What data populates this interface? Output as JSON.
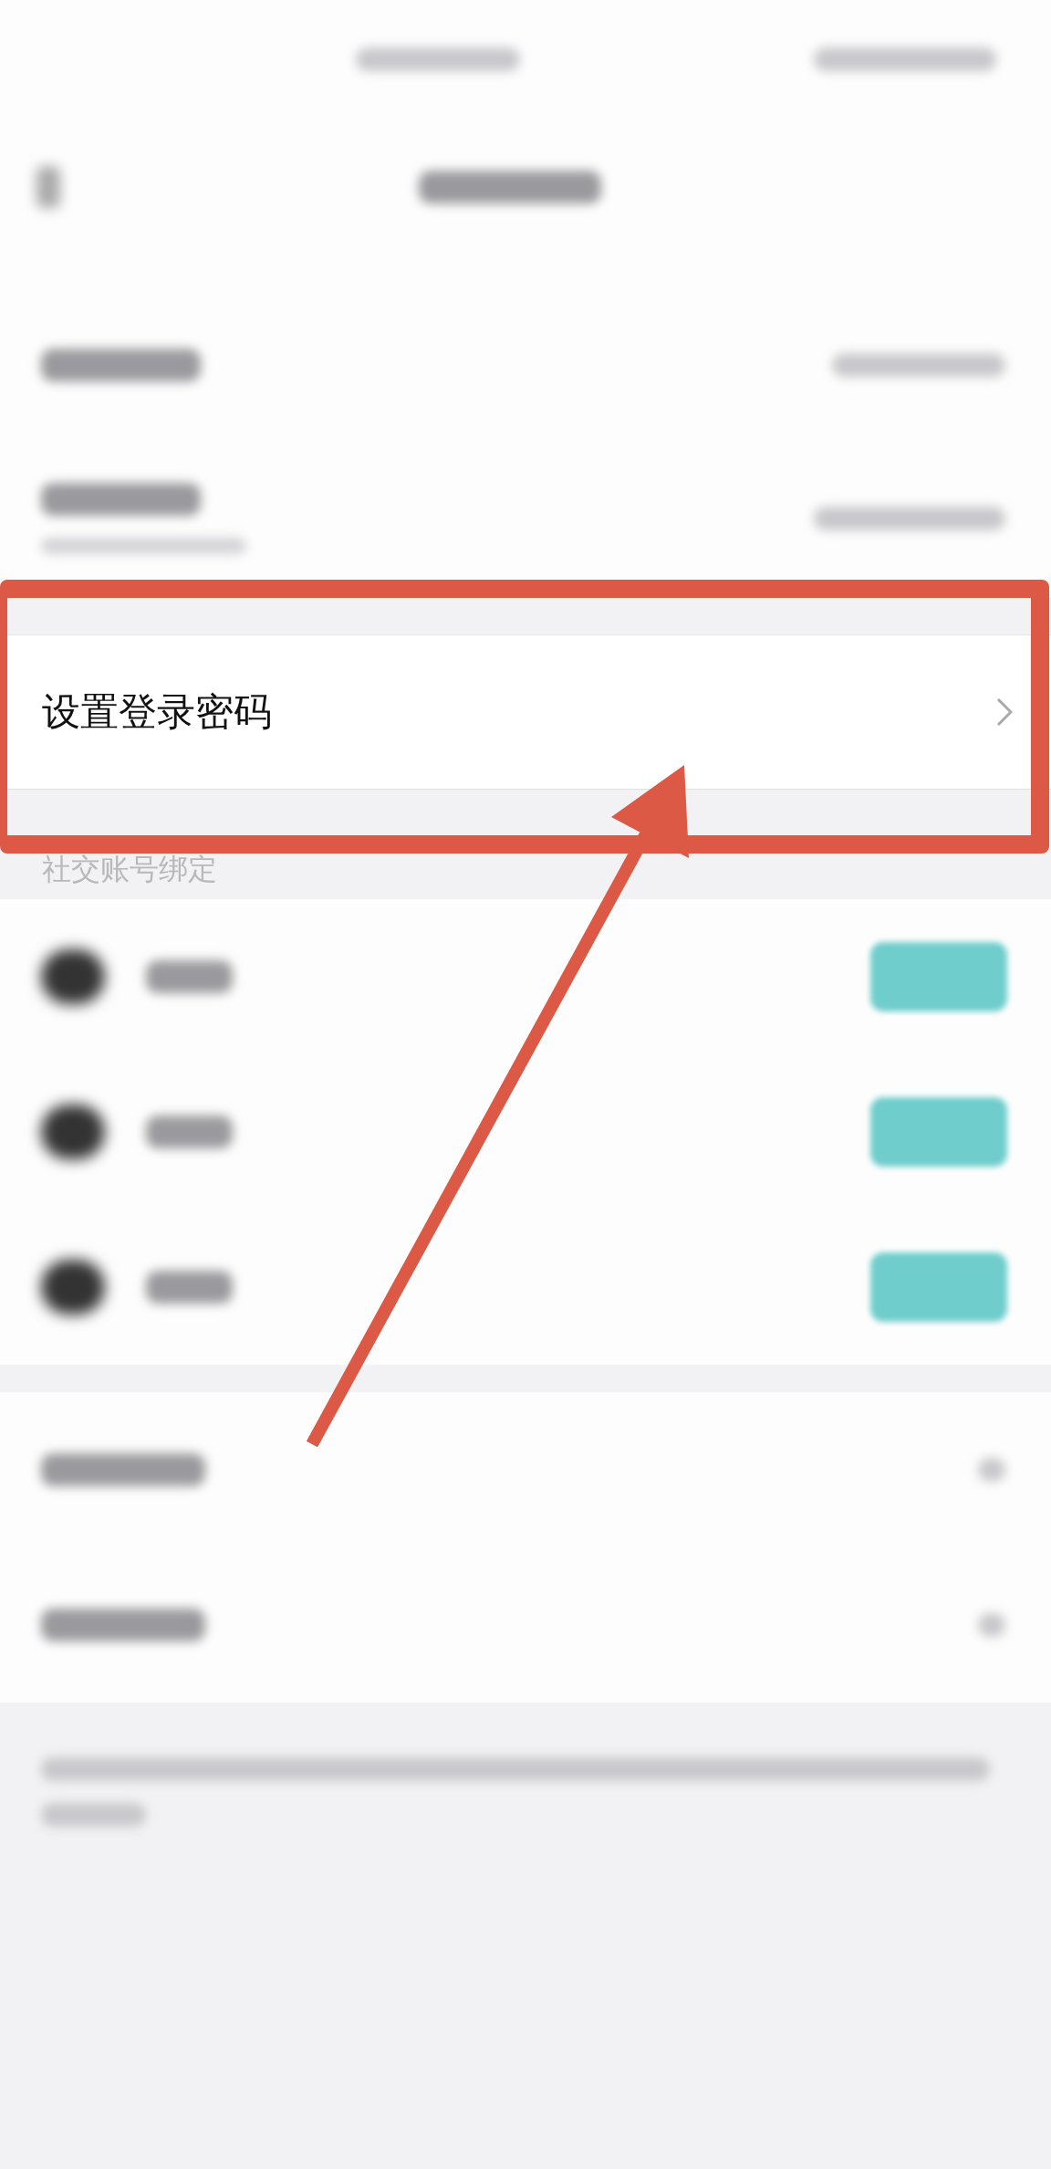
{
  "password_row": {
    "label": "设置登录密码"
  },
  "social_section": {
    "header": "社交账号绑定"
  }
}
